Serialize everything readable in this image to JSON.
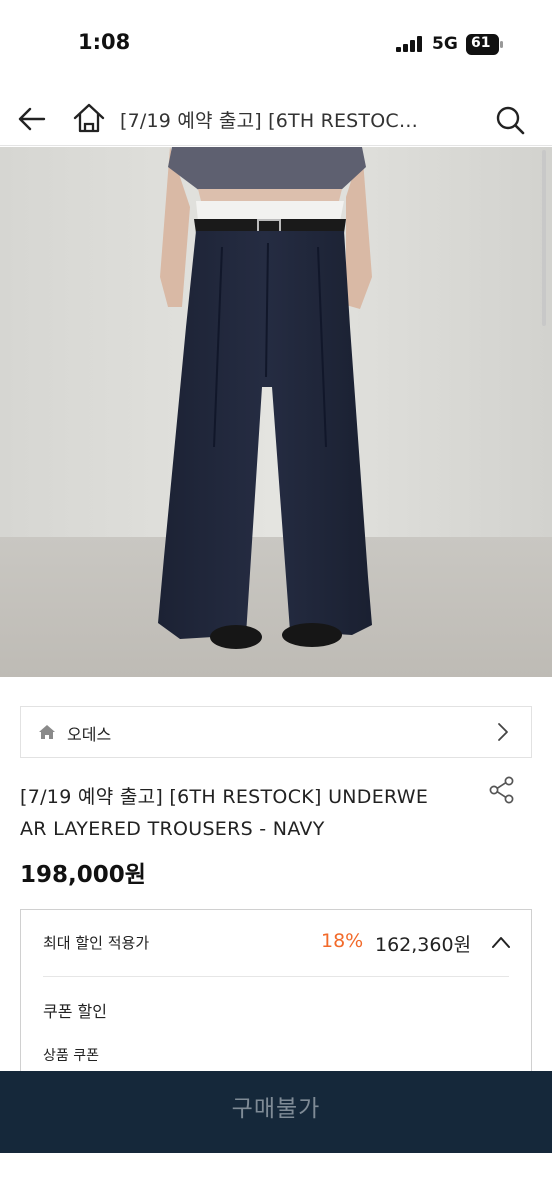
{
  "status": {
    "time": "1:08",
    "network": "5G",
    "battery": "61"
  },
  "nav": {
    "title": "[7/19 예약 출고] [6TH RESTOC…",
    "icons": [
      "back-arrow-icon",
      "home-icon",
      "search-icon"
    ]
  },
  "hero": {
    "image_description_icon": "product-photo"
  },
  "brand": {
    "name": "오데스"
  },
  "product": {
    "title_line1": "[7/19 예약 출고] [6TH RESTOCK] UNDERWE",
    "title_line2": "AR LAYERED TROUSERS - NAVY",
    "price": "198,000원"
  },
  "discount": {
    "label": "최대 할인 적용가",
    "percent": "18%",
    "price": "162,360원",
    "coupon_label": "쿠폰 할인",
    "coupon_sub": "상품 쿠폰"
  },
  "buy": {
    "label": "구매불가"
  },
  "colors": {
    "accent": "#f26a2a",
    "buy_bar": "#15283a",
    "buy_text": "#7f8b96"
  }
}
